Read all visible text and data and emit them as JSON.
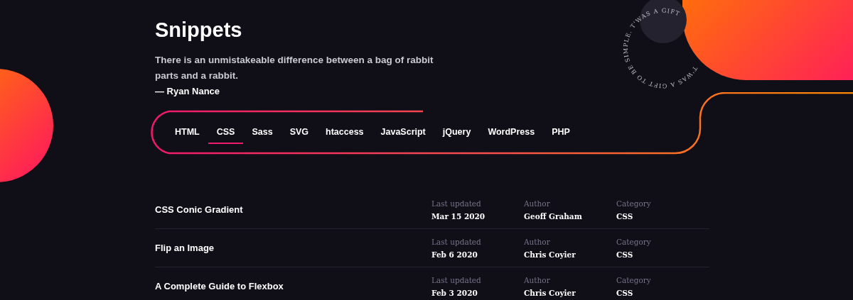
{
  "title": "Snippets",
  "quote": {
    "text": "There is an unmistakeable difference between a bag of rabbit parts and a rabbit.",
    "attribution": "— Ryan Nance"
  },
  "badge_text": "T'WAS A GIFT TO BE SIMPLE. T'WAS A GIFT",
  "tabs": [
    {
      "label": "HTML",
      "selected": false
    },
    {
      "label": "CSS",
      "selected": true
    },
    {
      "label": "Sass",
      "selected": false
    },
    {
      "label": "SVG",
      "selected": false
    },
    {
      "label": "htaccess",
      "selected": false
    },
    {
      "label": "JavaScript",
      "selected": false
    },
    {
      "label": "jQuery",
      "selected": false
    },
    {
      "label": "WordPress",
      "selected": false
    },
    {
      "label": "PHP",
      "selected": false
    }
  ],
  "snippets": [
    {
      "title": "CSS Conic Gradient",
      "fields": [
        {
          "label": "Last updated",
          "value": "Mar 15 2020"
        },
        {
          "label": "Author",
          "value": "Geoff Graham"
        },
        {
          "label": "Category",
          "value": "CSS"
        }
      ]
    },
    {
      "title": "Flip an Image",
      "fields": [
        {
          "label": "Last updated",
          "value": "Feb 6 2020"
        },
        {
          "label": "Author",
          "value": "Chris Coyier"
        },
        {
          "label": "Category",
          "value": "CSS"
        }
      ]
    },
    {
      "title": "A Complete Guide to Flexbox",
      "fields": [
        {
          "label": "Last updated",
          "value": "Feb 3 2020"
        },
        {
          "label": "Author",
          "value": "Chris Coyier"
        },
        {
          "label": "Category",
          "value": "CSS"
        }
      ]
    }
  ]
}
